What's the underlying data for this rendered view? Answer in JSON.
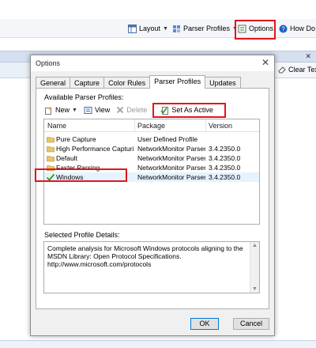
{
  "app": {
    "toolbar": {
      "layout": "Layout",
      "parser_profiles": "Parser Profiles",
      "options": "Options",
      "how_do": "How Do"
    },
    "clear_text": "Clear Tex"
  },
  "dialog": {
    "title": "Options",
    "tabs": [
      "General",
      "Capture",
      "Color Rules",
      "Parser Profiles",
      "Updates"
    ],
    "active_tab": "Parser Profiles",
    "available_label": "Available Parser Profiles:",
    "toolbar": {
      "new": "New",
      "view": "View",
      "delete": "Delete",
      "set_as_active": "Set As Active"
    },
    "columns": [
      "Name",
      "Package",
      "Version"
    ],
    "profiles": [
      {
        "name": "Pure Capture",
        "package": "User Defined Profile",
        "version": "",
        "icon": "profile-folder-icon"
      },
      {
        "name": "High Performance Capturing",
        "package": "NetworkMonitor Parsers",
        "version": "3.4.2350.0",
        "icon": "profile-folder-icon"
      },
      {
        "name": "Default",
        "package": "NetworkMonitor Parsers",
        "version": "3.4.2350.0",
        "icon": "profile-folder-icon"
      },
      {
        "name": "Faster Parsing",
        "package": "NetworkMonitor Parsers",
        "version": "3.4.2350.0",
        "icon": "profile-folder-icon"
      },
      {
        "name": "Windows",
        "package": "NetworkMonitor Parsers",
        "version": "3.4.2350.0",
        "icon": "active-checkmark-icon",
        "active": true
      }
    ],
    "details_label": "Selected Profile Details:",
    "details_text": "Complete analysis for Microsoft Windows protocols aligning to the MSDN Library: Open Protocol Specifications.\nhttp://www.microsoft.com/protocols",
    "ok_label": "OK",
    "cancel_label": "Cancel"
  },
  "colors": {
    "highlight": "#e0161e",
    "selection": "#e5f3ff",
    "accent": "#0078d7"
  }
}
